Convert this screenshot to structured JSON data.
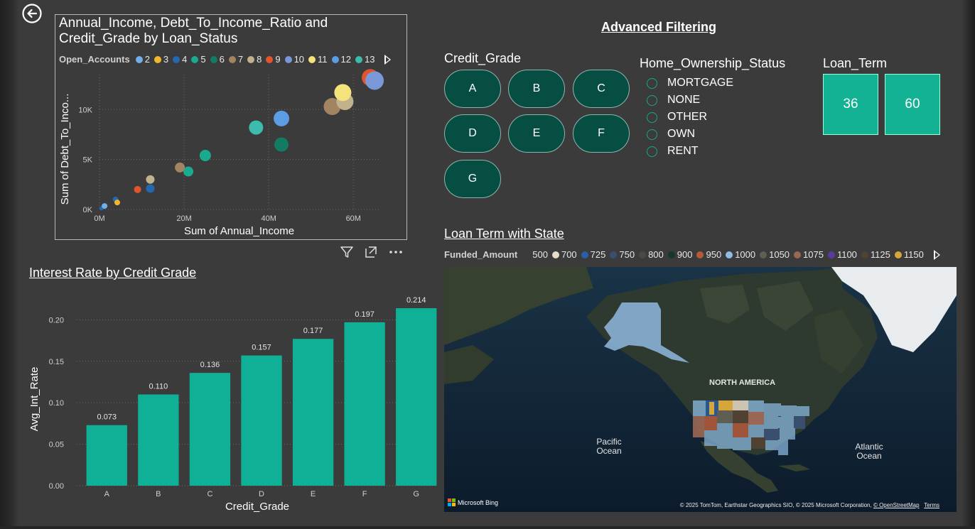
{
  "scatter": {
    "title": "Annual_Income, Debt_To_Income_Ratio and Credit_Grade by Loan_Status",
    "legend_label": "Open_Accounts",
    "legend": [
      {
        "label": "2",
        "color": "#6eb0e8"
      },
      {
        "label": "3",
        "color": "#f2b82b"
      },
      {
        "label": "4",
        "color": "#2369b0"
      },
      {
        "label": "5",
        "color": "#1aab8f"
      },
      {
        "label": "6",
        "color": "#137a64"
      },
      {
        "label": "7",
        "color": "#a28462"
      },
      {
        "label": "8",
        "color": "#c2b28c"
      },
      {
        "label": "9",
        "color": "#e2552c"
      },
      {
        "label": "10",
        "color": "#7a98d8"
      },
      {
        "label": "11",
        "color": "#f4e27a"
      },
      {
        "label": "12",
        "color": "#5b9ce5"
      },
      {
        "label": "13",
        "color": "#3cbcac"
      }
    ],
    "xlabel": "Sum of Annual_Income",
    "ylabel": "Sum of Debt_To_Inco...",
    "x_ticks": [
      "0M",
      "20M",
      "40M",
      "60M"
    ],
    "y_ticks": [
      "0K",
      "5K",
      "10K"
    ]
  },
  "scatter_data": {
    "type": "scatter",
    "xlim": [
      0,
      66
    ],
    "ylim": [
      0,
      13500
    ],
    "points": [
      {
        "x": 0.5,
        "y": 120,
        "c": "#2369b0",
        "r": 3
      },
      {
        "x": 1.2,
        "y": 350,
        "c": "#6eb0e8",
        "r": 4
      },
      {
        "x": 3.8,
        "y": 1000,
        "c": "#2369b0",
        "r": 4
      },
      {
        "x": 4.2,
        "y": 700,
        "c": "#f2b82b",
        "r": 4
      },
      {
        "x": 9,
        "y": 2000,
        "c": "#e2552c",
        "r": 5
      },
      {
        "x": 12,
        "y": 3000,
        "c": "#c2b28c",
        "r": 6
      },
      {
        "x": 12,
        "y": 2100,
        "c": "#2369b0",
        "r": 6
      },
      {
        "x": 19,
        "y": 4200,
        "c": "#a28462",
        "r": 7
      },
      {
        "x": 21,
        "y": 3800,
        "c": "#1aab8f",
        "r": 7
      },
      {
        "x": 25,
        "y": 5400,
        "c": "#1aab8f",
        "r": 8
      },
      {
        "x": 37,
        "y": 8200,
        "c": "#3cbcac",
        "r": 10
      },
      {
        "x": 43,
        "y": 9100,
        "c": "#5b9ce5",
        "r": 11
      },
      {
        "x": 43,
        "y": 6500,
        "c": "#137a64",
        "r": 10
      },
      {
        "x": 55,
        "y": 10300,
        "c": "#a28462",
        "r": 12
      },
      {
        "x": 58,
        "y": 10800,
        "c": "#c2b28c",
        "r": 12
      },
      {
        "x": 57.5,
        "y": 11700,
        "c": "#f4e27a",
        "r": 12
      },
      {
        "x": 64,
        "y": 13200,
        "c": "#e2552c",
        "r": 12
      },
      {
        "x": 65,
        "y": 12900,
        "c": "#7a98d8",
        "r": 13
      }
    ]
  },
  "bar": {
    "title": "Interest Rate by Credit Grade",
    "xlabel": "Credit_Grade",
    "ylabel": "Avg_Int_Rate",
    "color": "#0fb095"
  },
  "chart_data": {
    "type": "bar",
    "categories": [
      "A",
      "B",
      "C",
      "D",
      "E",
      "F",
      "G"
    ],
    "values": [
      0.073,
      0.11,
      0.136,
      0.157,
      0.177,
      0.197,
      0.214
    ],
    "value_labels": [
      "0.073",
      "0.110",
      "0.136",
      "0.157",
      "0.177",
      "0.197",
      "0.214"
    ],
    "y_ticks": [
      "0.00",
      "0.05",
      "0.10",
      "0.15",
      "0.20"
    ],
    "ylim": [
      0,
      0.226
    ],
    "xlabel": "Credit_Grade",
    "ylabel": "Avg_Int_Rate",
    "grid": true
  },
  "filters": {
    "title": "Advanced Filtering",
    "credit_grade": {
      "title": "Credit_Grade",
      "options": [
        "A",
        "B",
        "C",
        "D",
        "E",
        "F",
        "G"
      ]
    },
    "home_ownership": {
      "title": "Home_Ownership_Status",
      "options": [
        "MORTGAGE",
        "NONE",
        "OTHER",
        "OWN",
        "RENT"
      ]
    },
    "loan_term": {
      "title": "Loan_Term",
      "options": [
        "36",
        "60"
      ]
    }
  },
  "map": {
    "title": "Loan Term with State",
    "legend_label": "Funded_Amount",
    "legend": [
      {
        "label": "500",
        "color": "#3d3a3a"
      },
      {
        "label": "700",
        "color": "#e8dcc8"
      },
      {
        "label": "725",
        "color": "#2a5fa8"
      },
      {
        "label": "750",
        "color": "#3a4e6e"
      },
      {
        "label": "800",
        "color": "#4a4a44"
      },
      {
        "label": "900",
        "color": "#16372c"
      },
      {
        "label": "950",
        "color": "#b45a3c"
      },
      {
        "label": "1000",
        "color": "#8ebde6"
      },
      {
        "label": "1050",
        "color": "#5e5e52"
      },
      {
        "label": "1075",
        "color": "#9b6755"
      },
      {
        "label": "1100",
        "color": "#5a3aa0"
      },
      {
        "label": "1125",
        "color": "#4f4232"
      },
      {
        "label": "1150",
        "color": "#d6a63a"
      }
    ],
    "region_label": "NORTH AMERICA",
    "pacific_label": "Pacific Ocean",
    "atlantic_label": "Atlantic Ocean",
    "bing_label": "Microsoft Bing",
    "credit": "© 2025 TomTom, Earthstar Geographics SIO, © 2025 Microsoft Corporation,",
    "credit_osm": "© OpenStreetMap",
    "credit_terms": "Terms"
  }
}
